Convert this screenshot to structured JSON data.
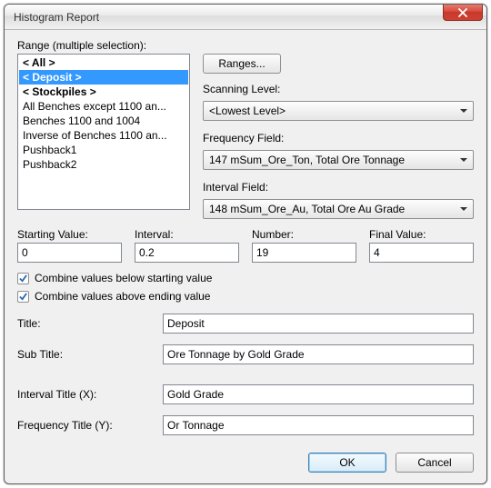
{
  "window": {
    "title": "Histogram Report"
  },
  "range": {
    "label": "Range (multiple selection):",
    "items": [
      {
        "text": "< All >",
        "bold": true,
        "selected": false
      },
      {
        "text": "< Deposit >",
        "bold": true,
        "selected": true
      },
      {
        "text": "< Stockpiles >",
        "bold": true,
        "selected": false
      },
      {
        "text": "All Benches except 1100 an...",
        "bold": false,
        "selected": false
      },
      {
        "text": "Benches 1100 and 1004",
        "bold": false,
        "selected": false
      },
      {
        "text": "Inverse of Benches 1100 an...",
        "bold": false,
        "selected": false
      },
      {
        "text": "Pushback1",
        "bold": false,
        "selected": false
      },
      {
        "text": "Pushback2",
        "bold": false,
        "selected": false
      }
    ]
  },
  "buttons": {
    "ranges": "Ranges...",
    "ok": "OK",
    "cancel": "Cancel"
  },
  "scanning": {
    "label": "Scanning Level:",
    "value": "<Lowest Level>"
  },
  "frequency": {
    "label": "Frequency Field:",
    "value": "147 mSum_Ore_Ton, Total Ore Tonnage"
  },
  "interval": {
    "label": "Interval Field:",
    "value": "148 mSum_Ore_Au, Total Ore Au Grade"
  },
  "starting": {
    "label": "Starting Value:",
    "value": "0"
  },
  "intervalVal": {
    "label": "Interval:",
    "value": "0.2"
  },
  "number": {
    "label": "Number:",
    "value": "19"
  },
  "final": {
    "label": "Final Value:",
    "value": "4"
  },
  "checkboxes": {
    "below": "Combine values below starting value",
    "above": "Combine values above ending value"
  },
  "titles": {
    "titleLabel": "Title:",
    "titleValue": "Deposit",
    "subTitleLabel": "Sub Title:",
    "subTitleValue": "Ore Tonnage by Gold Grade",
    "intervalTitleLabel": "Interval Title (X):",
    "intervalTitleValue": "Gold Grade",
    "frequencyTitleLabel": "Frequency Title (Y):",
    "frequencyTitleValue": "Or Tonnage"
  }
}
